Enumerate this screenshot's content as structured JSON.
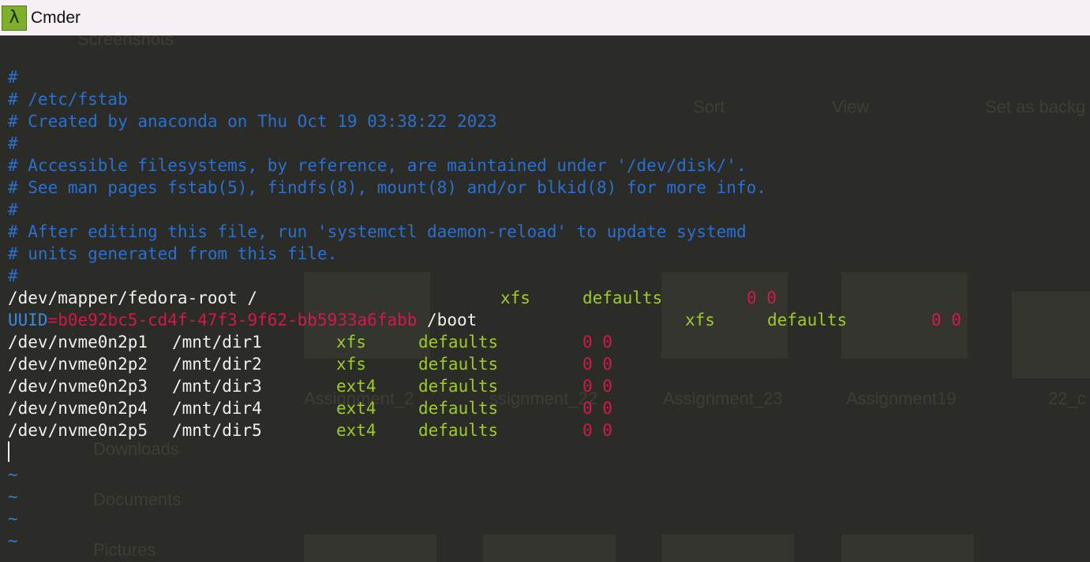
{
  "window": {
    "title": "Cmder",
    "icon": "lambda-icon",
    "icon_glyph": "λ"
  },
  "background_ghost": {
    "folder_title": "Screenshots",
    "sort_label": "Sort",
    "view_label": "View",
    "set_as_background": "Set as backg",
    "items": [
      "Assignment_2",
      "ssignment_22",
      "Assignment_23",
      "Assignment19",
      "22_c"
    ],
    "nav": [
      "Downloads",
      "Documents",
      "Pictures"
    ]
  },
  "file": {
    "comments": [
      "#",
      "# /etc/fstab",
      "# Created by anaconda on Thu Oct 19 03:38:22 2023",
      "#",
      "# Accessible filesystems, by reference, are maintained under '/dev/disk/'.",
      "# See man pages fstab(5), findfs(8), mount(8) and/or blkid(8) for more info.",
      "#",
      "# After editing this file, run 'systemctl daemon-reload' to update systemd",
      "# units generated from this file.",
      "#"
    ],
    "root_entry": {
      "device": "/dev/mapper/fedora-root /",
      "fstype": "xfs",
      "options": "defaults",
      "dump_pass": "0 0"
    },
    "boot_entry": {
      "uuid_key": "UUID",
      "equals": "=",
      "uuid_value": "b0e92bc5-cd4f-47f3-9f62-bb5933a6fabb",
      "mount": " /boot",
      "fstype": "xfs",
      "options": "defaults",
      "dump_pass": "0 0"
    },
    "entries": [
      {
        "device": "/dev/nvme0n2p1",
        "mount": "/mnt/dir1",
        "fstype": "xfs",
        "options": "defaults",
        "dump_pass": "0 0"
      },
      {
        "device": "/dev/nvme0n2p2",
        "mount": "/mnt/dir2",
        "fstype": "xfs",
        "options": "defaults",
        "dump_pass": "0 0"
      },
      {
        "device": "/dev/nvme0n2p3",
        "mount": "/mnt/dir3",
        "fstype": "ext4",
        "options": "defaults",
        "dump_pass": "0 0"
      },
      {
        "device": "/dev/nvme0n2p4",
        "mount": "/mnt/dir4",
        "fstype": "ext4",
        "options": "defaults",
        "dump_pass": "0 0"
      },
      {
        "device": "/dev/nvme0n2p5",
        "mount": "/mnt/dir5",
        "fstype": "ext4",
        "options": "defaults",
        "dump_pass": "0 0"
      }
    ],
    "tildes": [
      "~",
      "~",
      "~",
      "~"
    ]
  },
  "colors": {
    "background": "#2b2c27",
    "comment": "#2a70d0",
    "text": "#f0f0ec",
    "green": "#9fcb2a",
    "red": "#d01b48"
  }
}
